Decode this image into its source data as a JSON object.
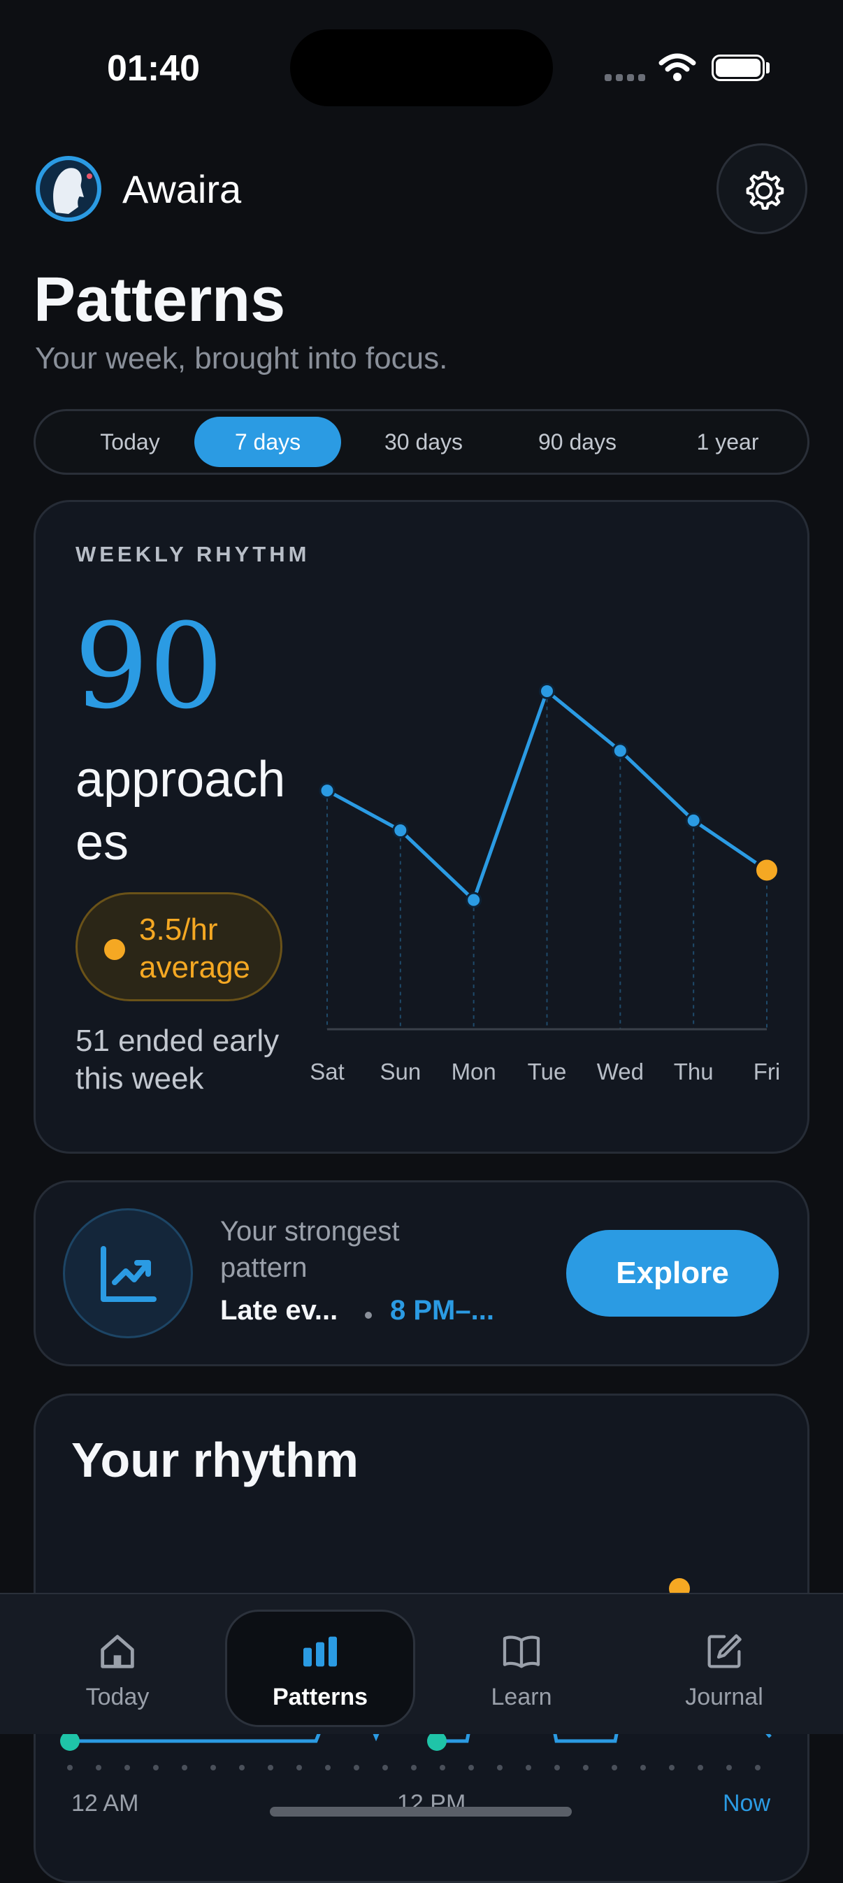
{
  "status_bar": {
    "time": "01:40"
  },
  "header": {
    "app_name": "Awaira"
  },
  "page": {
    "title": "Patterns",
    "subtitle": "Your week, brought into focus."
  },
  "range_tabs": [
    {
      "label": "Today",
      "active": false
    },
    {
      "label": "7 days",
      "active": true
    },
    {
      "label": "30 days",
      "active": false
    },
    {
      "label": "90 days",
      "active": false
    },
    {
      "label": "1 year",
      "active": false
    }
  ],
  "weekly_card": {
    "kicker": "WEEKLY RHYTHM",
    "count": "90",
    "unit": "approaches",
    "average": "3.5/hr average",
    "ended_early": "51 ended early this week"
  },
  "chart_data": {
    "type": "line",
    "categories": [
      "Sat",
      "Sun",
      "Mon",
      "Tue",
      "Wed",
      "Thu",
      "Fri"
    ],
    "values": [
      12,
      10,
      6.5,
      17,
      14,
      10.5,
      8
    ],
    "ylim": [
      0,
      18
    ],
    "grid": false,
    "highlight_last": true,
    "colors": {
      "line": "#2b9be3",
      "highlight": "#f5a823"
    }
  },
  "strongest_card": {
    "label": "Your strongest pattern",
    "pattern": "Late ev...",
    "time_range": "8 PM–...",
    "button": "Explore"
  },
  "rhythm_card": {
    "title": "Your rhythm"
  },
  "tab_bar": [
    {
      "label": "Today",
      "icon": "home-icon",
      "active": false
    },
    {
      "label": "Patterns",
      "icon": "bar-chart-icon",
      "active": true
    },
    {
      "label": "Learn",
      "icon": "book-icon",
      "active": false
    },
    {
      "label": "Journal",
      "icon": "compose-icon",
      "active": false
    }
  ],
  "timeline": {
    "start": "12 AM",
    "mid": "12 PM",
    "end": "Now"
  },
  "colors": {
    "accent": "#2b9be3",
    "warning": "#f5a823",
    "background": "#0d0f13",
    "card": "#121720"
  }
}
